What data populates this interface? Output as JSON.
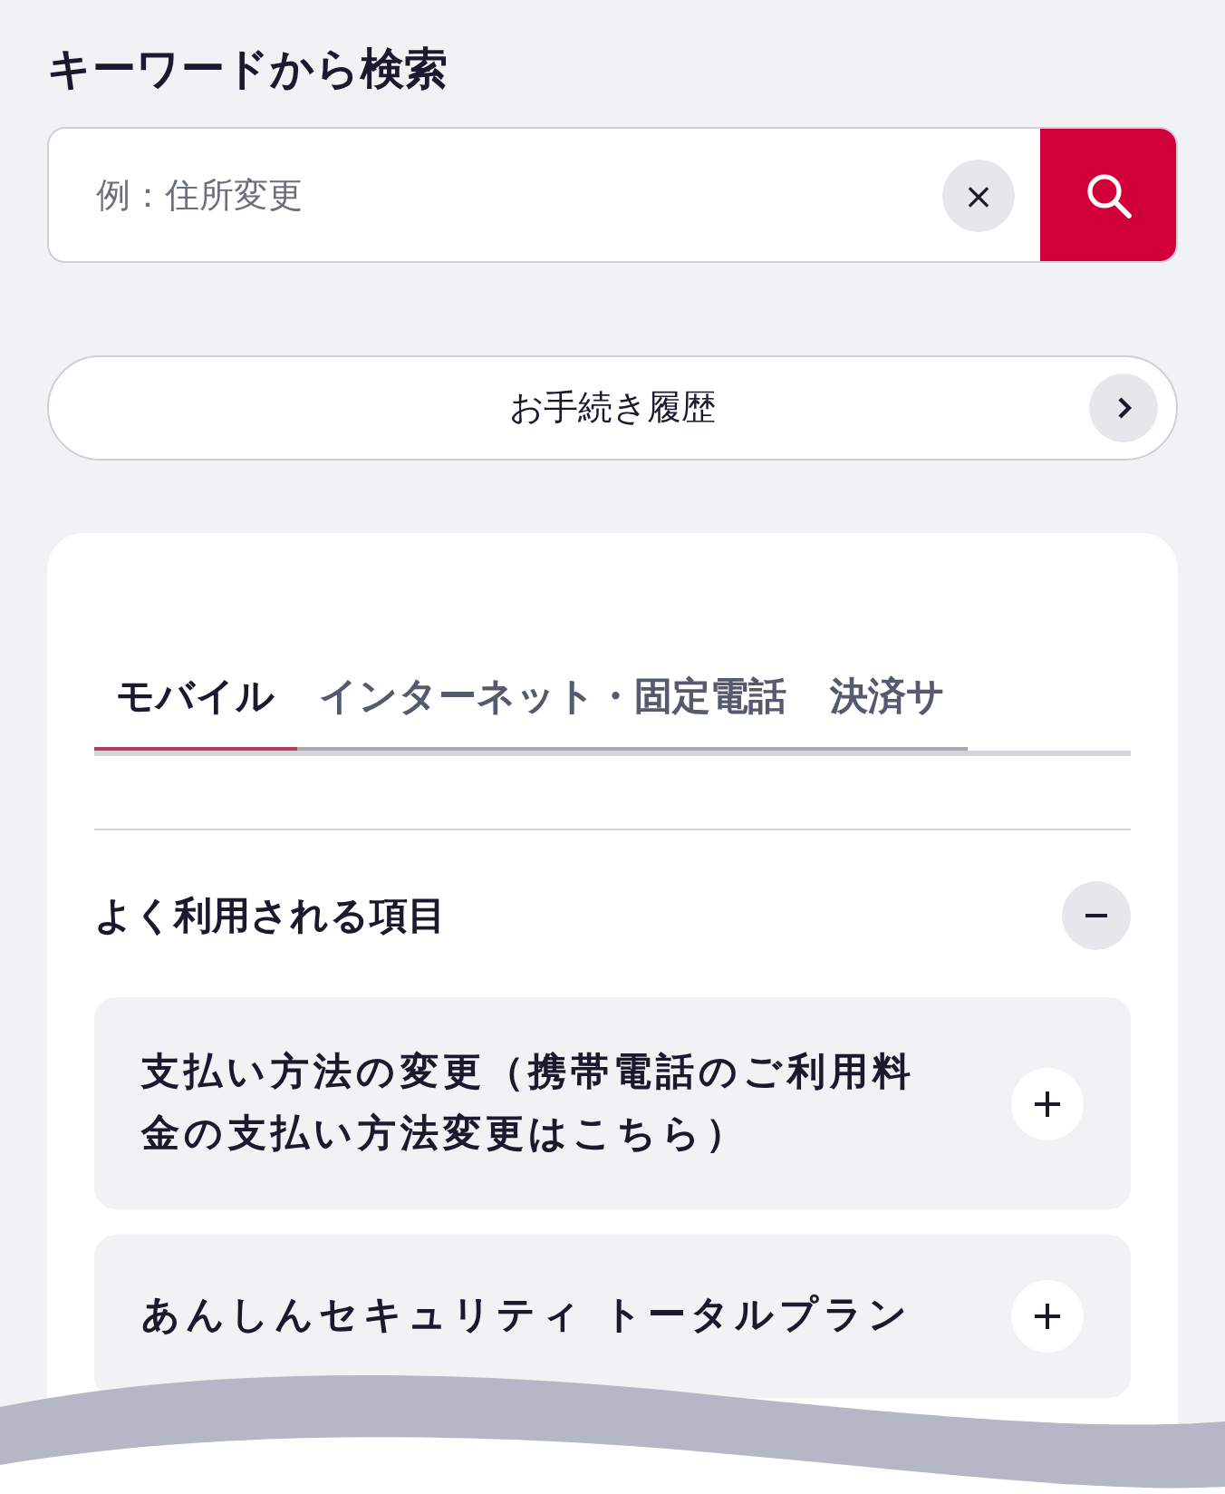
{
  "title": "キーワードから検索",
  "search": {
    "placeholder": "例：住所変更",
    "clear_label": "×"
  },
  "history_button": {
    "label": "お手続き履歴"
  },
  "tabs": [
    {
      "label": "モバイル",
      "selected": true
    },
    {
      "label": "インターネット・固定電話",
      "selected": false
    },
    {
      "label": "決済サ",
      "selected": false
    }
  ],
  "section": {
    "title": "よく利用される項目",
    "expanded": true
  },
  "items": [
    {
      "label": "支払い方法の変更（携帯電話のご利用料金の支払い方法変更はこちら）",
      "expanded": false
    },
    {
      "label": "あんしんセキュリティ トータルプラン",
      "expanded": false
    }
  ]
}
